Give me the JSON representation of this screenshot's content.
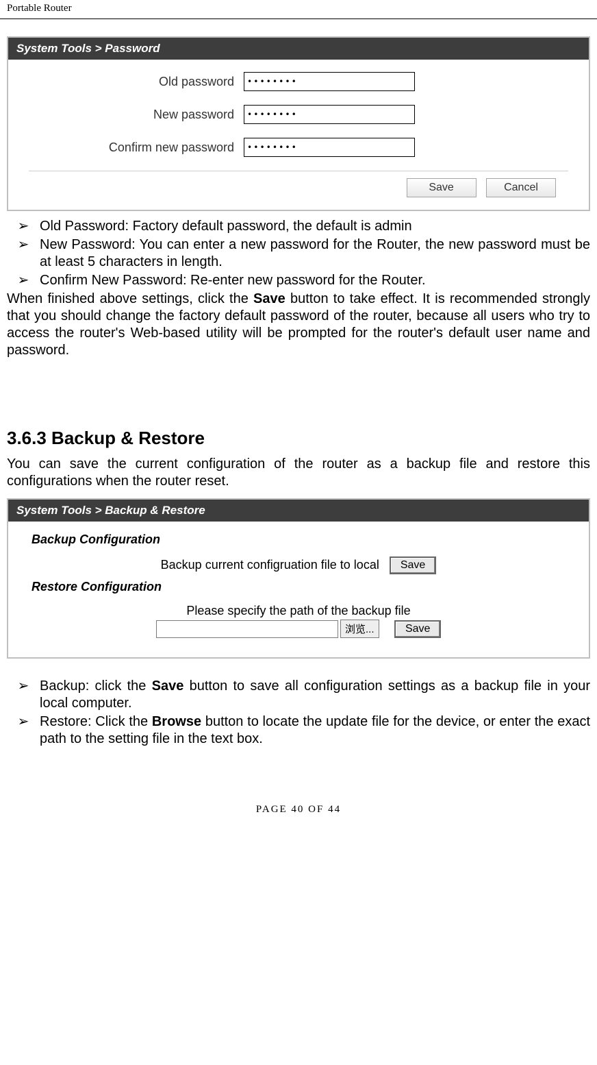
{
  "header": {
    "title": "Portable Router"
  },
  "password_panel": {
    "title": "System Tools > Password",
    "fields": {
      "old_label": "Old password",
      "old_value": "••••••••",
      "new_label": "New password",
      "new_value": "••••••••",
      "confirm_label": "Confirm new password",
      "confirm_value": "••••••••"
    },
    "buttons": {
      "save": "Save",
      "cancel": "Cancel"
    }
  },
  "bullets_1": {
    "mark": "➢",
    "b1": "Old Password: Factory default password, the default is admin",
    "b2": "New Password: You can enter a new password for the Router, the new password must be at least 5 characters in length.",
    "b3": "Confirm New Password: Re-enter new password for the Router."
  },
  "para_1": {
    "pre": "When finished above settings, click the ",
    "bold": "Save",
    "post": " button to take effect. It is recommended strongly that you should change the factory default password of the router, because all users who try to access the router's Web-based utility will be prompted for the router's default user name and password."
  },
  "section_2": {
    "heading": "3.6.3 Backup & Restore",
    "intro": "You can save the current configuration of the router as a backup file and restore this configurations when the router reset."
  },
  "backup_panel": {
    "title": "System Tools > Backup & Restore",
    "backup_sub": "Backup Configuration",
    "backup_text": "Backup current configruation file to local",
    "backup_btn": "Save",
    "restore_sub": "Restore Configuration",
    "restore_text": "Please specify the path of the backup file",
    "browse_btn": "浏览...",
    "restore_btn": "Save"
  },
  "bullets_2": {
    "mark": "➢",
    "b1_pre": "Backup: click the ",
    "b1_bold": "Save",
    "b1_post": " button to save all configuration settings as a backup file in your local computer.",
    "b2_pre": "Restore: Click the ",
    "b2_bold": "Browse",
    "b2_post": " button to locate the update file for the device, or enter the exact path to the setting file in the text box."
  },
  "footer": {
    "text": "PAGE  40  OF  44"
  }
}
